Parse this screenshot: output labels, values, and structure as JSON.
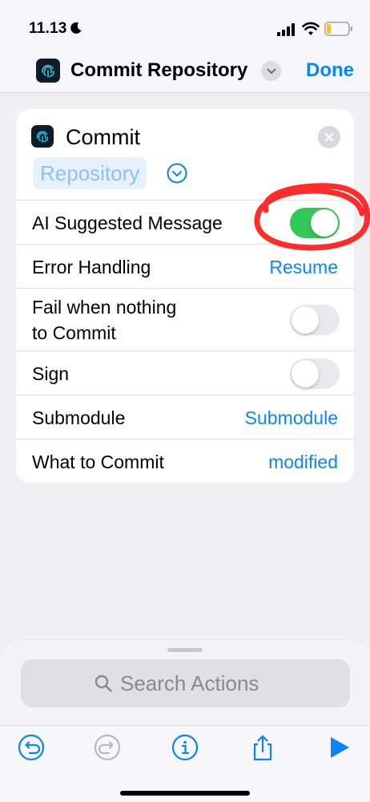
{
  "status_bar": {
    "time": "11.13",
    "icons": [
      "moon-icon",
      "cellular-signal-icon",
      "wifi-icon",
      "battery-low-icon"
    ]
  },
  "nav": {
    "title": "Commit Repository",
    "done_label": "Done",
    "icons": [
      "fingerprint-app-icon",
      "chevron-down-icon"
    ]
  },
  "action": {
    "title": "Commit",
    "parameter": "Repository",
    "icons": [
      "fingerprint-app-icon",
      "close-icon",
      "expand-chevron-icon"
    ],
    "rows": [
      {
        "label": "AI Suggested Message",
        "type": "toggle",
        "value": true
      },
      {
        "label": "Error Handling",
        "type": "value",
        "value": "Resume"
      },
      {
        "label": "Fail when nothing to Commit",
        "label_line1": "Fail when nothing",
        "label_line2": "to Commit",
        "type": "toggle",
        "value": false
      },
      {
        "label": "Sign",
        "type": "toggle",
        "value": false
      },
      {
        "label": "Submodule",
        "type": "value",
        "value": "Submodule"
      },
      {
        "label": "What to Commit",
        "type": "value",
        "value": "modified"
      }
    ]
  },
  "search": {
    "placeholder": "Search Actions"
  },
  "toolbar": {
    "items": [
      "undo-icon",
      "redo-icon",
      "info-icon",
      "share-icon",
      "play-icon"
    ]
  },
  "colors": {
    "accent": "#0a84ff",
    "toggle_on": "#34c759",
    "annotation": "#ff1a1a"
  }
}
